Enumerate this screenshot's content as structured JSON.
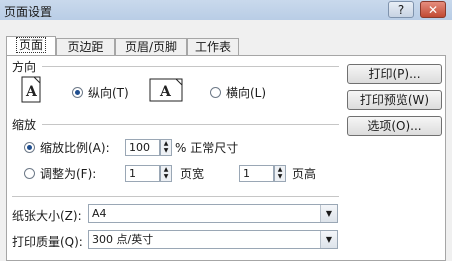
{
  "window": {
    "title": "页面设置",
    "help_glyph": "?",
    "close_glyph": "✕"
  },
  "tabs": [
    {
      "label": "页面"
    },
    {
      "label": "页边距"
    },
    {
      "label": "页眉/页脚"
    },
    {
      "label": "工作表"
    }
  ],
  "orientation": {
    "section_label": "方向",
    "portrait_label": "纵向(T)",
    "landscape_label": "横向(L)",
    "page_icon_letter": "A"
  },
  "scaling": {
    "section_label": "缩放",
    "adjust_label": "缩放比例(A):",
    "adjust_value": "100",
    "percent_suffix": "% 正常尺寸",
    "fit_label": "调整为(F):",
    "fit_wide_value": "1",
    "fit_wide_suffix": "页宽",
    "fit_tall_value": "1",
    "fit_tall_suffix": "页高"
  },
  "paper": {
    "size_label": "纸张大小(Z):",
    "size_value": "A4",
    "quality_label": "打印质量(Q):",
    "quality_value": "300 点/英寸"
  },
  "buttons": {
    "print": "打印(P)...",
    "preview": "打印预览(W)",
    "options": "选项(O)..."
  }
}
